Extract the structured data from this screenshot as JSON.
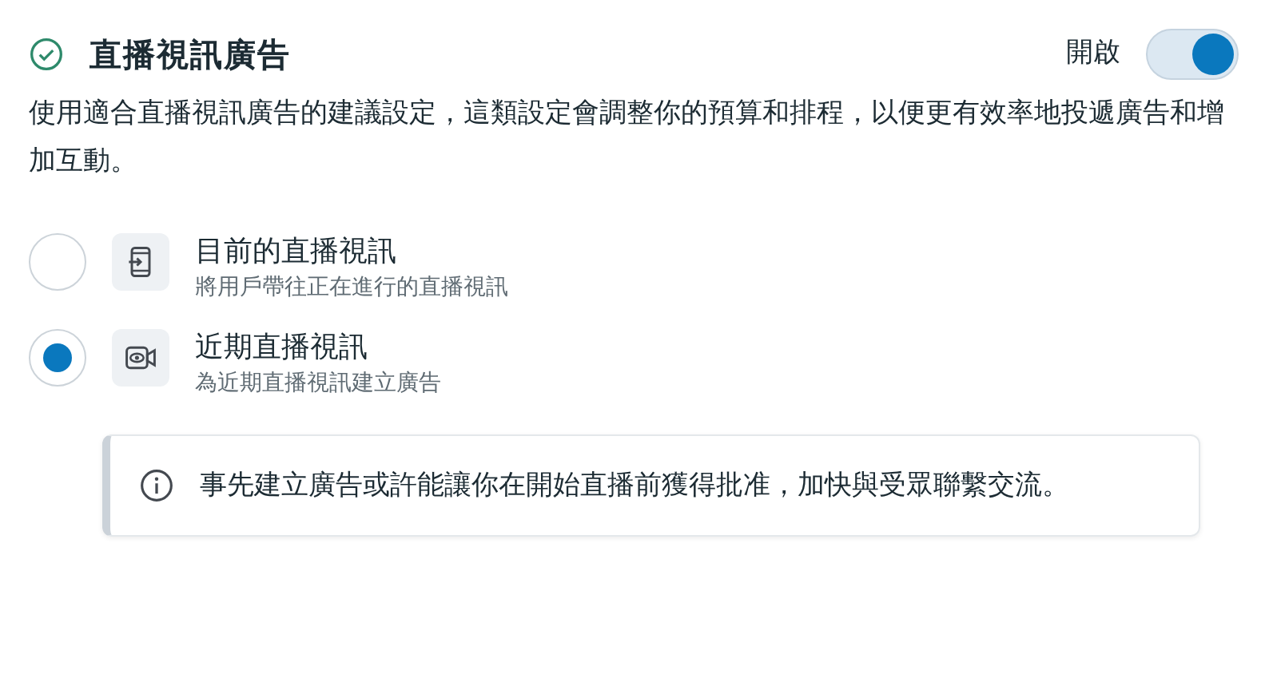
{
  "header": {
    "title": "直播視訊廣告",
    "toggle_label": "開啟",
    "toggle_on": true
  },
  "description": "使用適合直播視訊廣告的建議設定，這類設定會調整你的預算和排程，以便更有效率地投遞廣告和增加互動。",
  "options": [
    {
      "kind": "phone",
      "title": "目前的直播視訊",
      "subtitle": "將用戶帶往正在進行的直播視訊",
      "selected": false
    },
    {
      "kind": "camera",
      "title": "近期直播視訊",
      "subtitle": "為近期直播視訊建立廣告",
      "selected": true
    }
  ],
  "notice": "事先建立廣告或許能讓你在開始直播前獲得批准，加快與受眾聯繫交流。"
}
